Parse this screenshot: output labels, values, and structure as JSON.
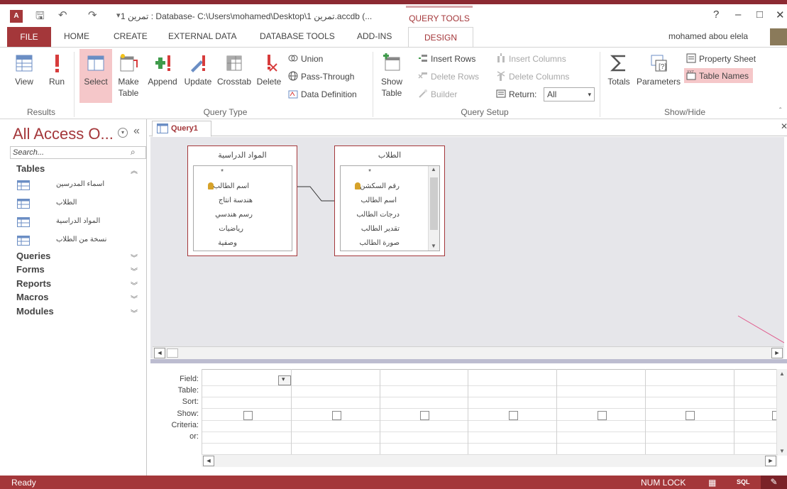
{
  "titlebar": {
    "title": "تمرين 1 : Database- C:\\Users\\mohamed\\Desktop\\تمرين 1.accdb (...",
    "context_tab": "QUERY TOOLS",
    "help": "?",
    "minimize": "–",
    "maximize": "□",
    "close": "✕"
  },
  "tabs": {
    "file": "FILE",
    "home": "HOME",
    "create": "CREATE",
    "external": "EXTERNAL DATA",
    "dbtools": "DATABASE TOOLS",
    "addins": "ADD-INS",
    "design": "DESIGN",
    "user": "mohamed abou elela"
  },
  "ribbon": {
    "results": {
      "view": "View",
      "run": "Run",
      "label": "Results"
    },
    "query_type": {
      "select": "Select",
      "make_table_1": "Make",
      "make_table_2": "Table",
      "append": "Append",
      "update": "Update",
      "crosstab": "Crosstab",
      "delete": "Delete",
      "union": "Union",
      "pass_through": "Pass-Through",
      "data_definition": "Data Definition",
      "label": "Query Type"
    },
    "query_setup": {
      "show_table_1": "Show",
      "show_table_2": "Table",
      "insert_rows": "Insert Rows",
      "delete_rows": "Delete Rows",
      "builder": "Builder",
      "insert_columns": "Insert Columns",
      "delete_columns": "Delete Columns",
      "return_label": "Return:",
      "return_value": "All",
      "label": "Query Setup"
    },
    "show_hide": {
      "totals": "Totals",
      "parameters": "Parameters",
      "property_sheet": "Property Sheet",
      "table_names": "Table Names",
      "label": "Show/Hide"
    }
  },
  "nav": {
    "title": "All Access O...",
    "search_placeholder": "Search...",
    "tables_header": "Tables",
    "tables": [
      "اسماء المدرسين",
      "الطلاب",
      "المواد الدراسية",
      "نسخة من الطلاب"
    ],
    "queries": "Queries",
    "forms": "Forms",
    "reports": "Reports",
    "macros": "Macros",
    "modules": "Modules"
  },
  "doc": {
    "tab": "Query1"
  },
  "tables_design": {
    "t1": {
      "name": "المواد الدراسية",
      "fields": [
        "*",
        "اسم الطالب",
        "هندسة انتاج",
        "رسم هندسي",
        "رياضيات",
        "وصفية"
      ]
    },
    "t2": {
      "name": "الطلاب",
      "fields": [
        "*",
        "رقم السكشن",
        "اسم الطالب",
        "درجات الطالب",
        "تقدير الطالب",
        "صورة الطالب"
      ]
    }
  },
  "grid": {
    "rows": [
      "Field:",
      "Table:",
      "Sort:",
      "Show:",
      "Criteria:",
      "or:"
    ]
  },
  "status": {
    "left": "Ready",
    "numlock": "NUM LOCK",
    "sql": "SQL"
  }
}
